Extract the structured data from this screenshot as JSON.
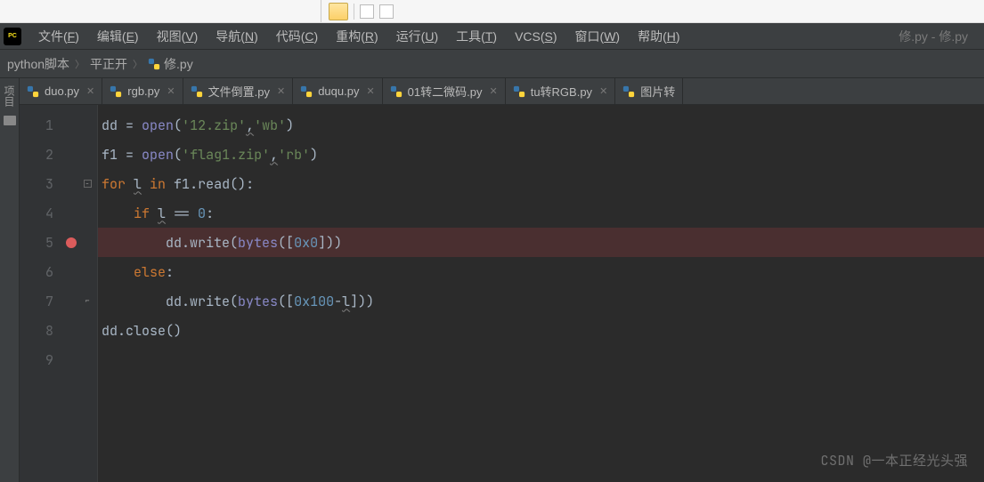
{
  "menu": {
    "items": [
      {
        "label": "文件(F)",
        "accel": "F"
      },
      {
        "label": "编辑(E)",
        "accel": "E"
      },
      {
        "label": "视图(V)",
        "accel": "V"
      },
      {
        "label": "导航(N)",
        "accel": "N"
      },
      {
        "label": "代码(C)",
        "accel": "C"
      },
      {
        "label": "重构(R)",
        "accel": "R"
      },
      {
        "label": "运行(U)",
        "accel": "U"
      },
      {
        "label": "工具(T)",
        "accel": "T"
      },
      {
        "label": "VCS(S)",
        "accel": "S"
      },
      {
        "label": "窗口(W)",
        "accel": "W"
      },
      {
        "label": "帮助(H)",
        "accel": "H"
      }
    ],
    "window_title": "修.py - 修.py"
  },
  "breadcrumb": {
    "items": [
      "python脚本",
      "平正开",
      "修.py"
    ]
  },
  "sidetool_label": "项目",
  "tabs": [
    {
      "label": "duo.py"
    },
    {
      "label": "rgb.py"
    },
    {
      "label": "文件倒置.py"
    },
    {
      "label": "duqu.py"
    },
    {
      "label": "01转二微码.py"
    },
    {
      "label": "tu转RGB.py"
    },
    {
      "label": "图片转"
    }
  ],
  "code": {
    "lines": [
      {
        "n": "1"
      },
      {
        "n": "2"
      },
      {
        "n": "3"
      },
      {
        "n": "4"
      },
      {
        "n": "5",
        "breakpoint": true,
        "highlight": true
      },
      {
        "n": "6"
      },
      {
        "n": "7"
      },
      {
        "n": "8"
      },
      {
        "n": "9"
      }
    ],
    "tokens": {
      "dd": "dd",
      "eq": " = ",
      "open": "open",
      "p1": "(",
      "p2": ")",
      "s_12zip": "'12.zip'",
      "s_wb": "'wb'",
      "s_flag1": "'flag1.zip'",
      "s_rb": "'rb'",
      "comma": ",",
      "f1": "f1",
      "for": "for ",
      "l": "l",
      "in": " in ",
      "read": ".read():",
      "if": "if ",
      "eqeq": " == ",
      "zero": "0",
      "colon": ":",
      "write": ".write(",
      "bytes": "bytes",
      "b1": "([",
      "hx0": "0x0",
      "b2": "]))",
      "else": "else",
      "hx100": "0x100",
      "minus": "-",
      "close": ".close()"
    }
  },
  "watermark": "CSDN @一本正经光头强"
}
